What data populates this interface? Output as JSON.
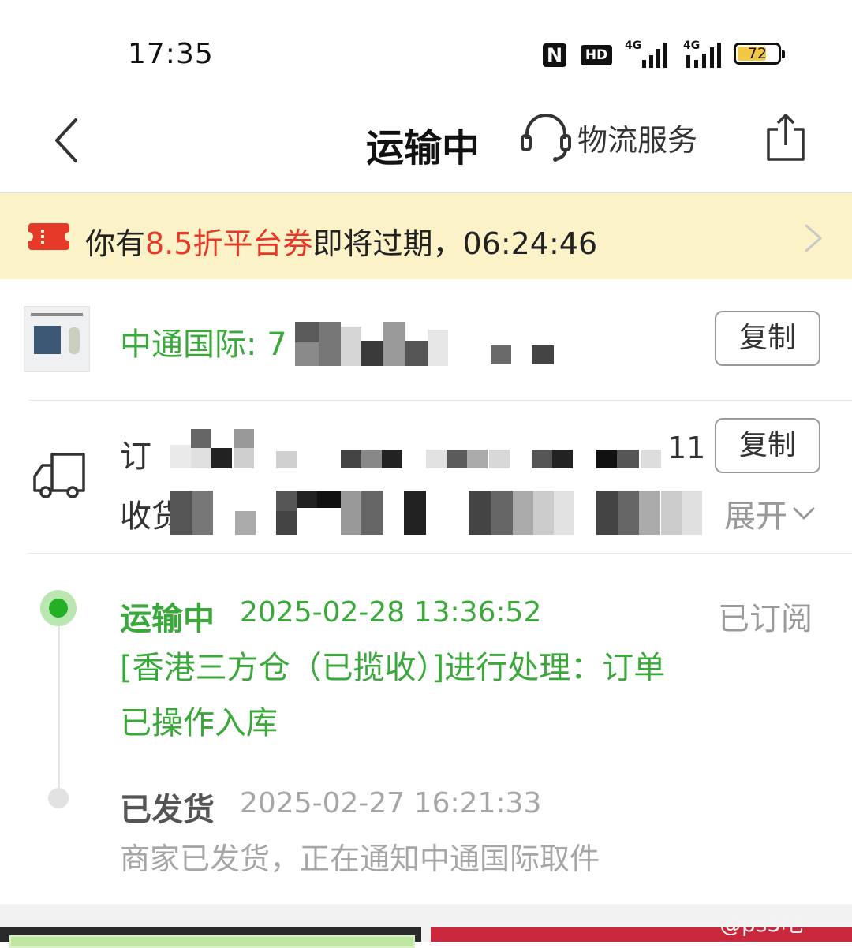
{
  "status_bar": {
    "time": "17:35",
    "nfc": "N",
    "hd": "HD",
    "signal1": "4G",
    "signal2": "4G",
    "battery": "72"
  },
  "header": {
    "back_icon": "back-chevron-icon",
    "title": "运输中",
    "service_icon": "headset-icon",
    "service_label": "物流服务",
    "share_icon": "share-icon"
  },
  "coupon": {
    "prefix": "你有",
    "highlight": "8.5折平台券",
    "suffix": "即将过期，",
    "countdown": "06:24:46",
    "accent_color": "#e53a2a"
  },
  "tracking": {
    "carrier": "中通国际: 7",
    "copy_label": "复制"
  },
  "order": {
    "order_prefix": "订",
    "order_tail": "11",
    "copy_label": "复制",
    "receiver_prefix": "收货",
    "expand_label": "展开"
  },
  "timeline": {
    "subscribed": "已订阅",
    "events": [
      {
        "status": "运输中",
        "time": "2025-02-28 13:36:52",
        "detail": "[香港三方仓（已揽收）]进行处理：订单已操作入库"
      },
      {
        "status": "已发货",
        "time": "2025-02-27 16:21:33",
        "detail": "商家已发货，正在通知中通国际取件"
      }
    ]
  },
  "watermark": "@ps5吧",
  "colors": {
    "green": "#3aa83a",
    "red": "#e53a2a",
    "banner_bg": "#fbf2c7"
  }
}
